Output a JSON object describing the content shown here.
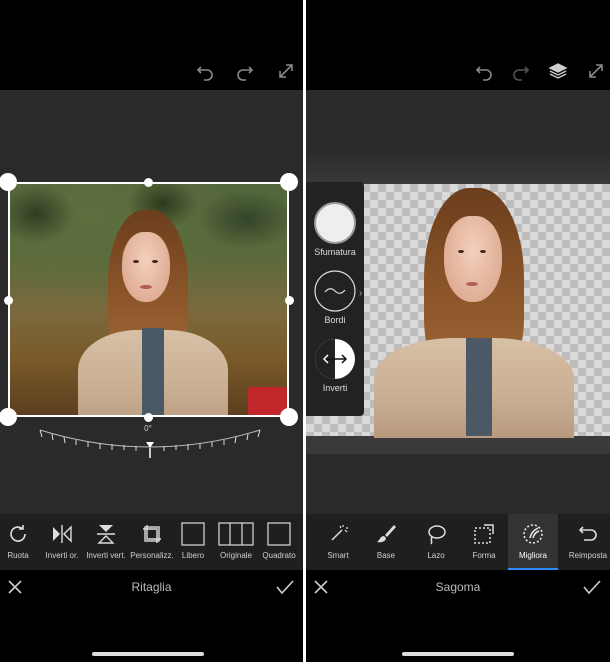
{
  "left_screen": {
    "rotation_label": "0°",
    "tools": [
      {
        "label": "Ruota",
        "icon": "rotate-icon"
      },
      {
        "label": "Inverti or.",
        "icon": "flip-horizontal-icon"
      },
      {
        "label": "Inverti vert.",
        "icon": "flip-vertical-icon"
      },
      {
        "label": "Personalizz.",
        "icon": "custom-crop-icon"
      },
      {
        "label": "Libero",
        "icon": "free-ratio-icon"
      },
      {
        "label": "Originale",
        "icon": "original-ratio-icon"
      },
      {
        "label": "Quadrato",
        "icon": "square-ratio-icon"
      }
    ],
    "footer_title": "Ritaglia"
  },
  "right_screen": {
    "side_panel": [
      {
        "label": "Sfumatura",
        "icon": "feather-icon"
      },
      {
        "label": "Bordi",
        "icon": "edges-wave-icon"
      },
      {
        "label": "Inverti",
        "icon": "invert-arrows-icon"
      }
    ],
    "tools": [
      {
        "label": "Smart",
        "icon": "smart-wand-icon"
      },
      {
        "label": "Base",
        "icon": "brush-icon"
      },
      {
        "label": "Lazo",
        "icon": "lasso-icon"
      },
      {
        "label": "Forma",
        "icon": "shape-icon"
      },
      {
        "label": "Migliora",
        "icon": "refine-icon"
      },
      {
        "label": "Reimposta",
        "icon": "reset-icon"
      }
    ],
    "active_tool": "Migliora",
    "footer_title": "Sagoma"
  },
  "colors": {
    "background": "#000000",
    "canvas": "#2a2a2a",
    "toolbar": "#1f1f1f",
    "accent": "#2a8cff"
  }
}
